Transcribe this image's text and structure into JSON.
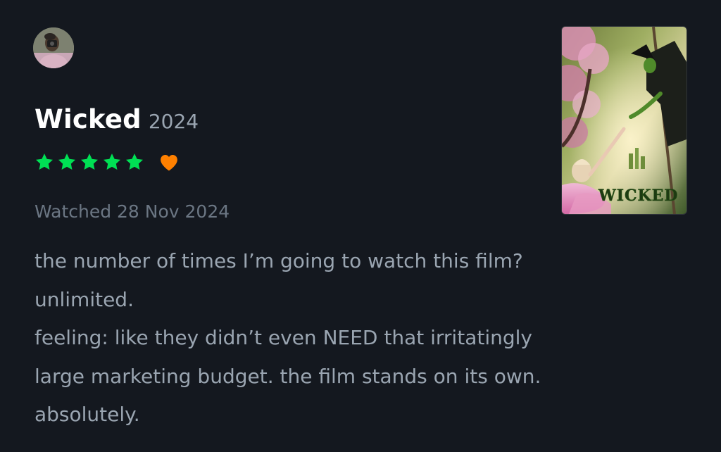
{
  "review": {
    "film_title": "Wicked",
    "film_year": "2024",
    "rating_stars": 5,
    "liked": true,
    "watched_label": "Watched 28 Nov 2024",
    "text_lines": [
      "the number of times I’m going to watch this film?",
      "unlimited.",
      "feeling: like they didn’t even NEED that irritatingly",
      "large marketing budget. the film stands on its own.",
      "absolutely."
    ]
  },
  "poster": {
    "title_text": "WICKED"
  },
  "colors": {
    "background": "#14181f",
    "star": "#00e054",
    "heart": "#ff8000",
    "title": "#ffffff",
    "text": "#9aa5b1",
    "muted": "#6b7683"
  },
  "icons": {
    "avatar": "user-avatar",
    "star": "star-icon",
    "heart": "heart-icon"
  }
}
